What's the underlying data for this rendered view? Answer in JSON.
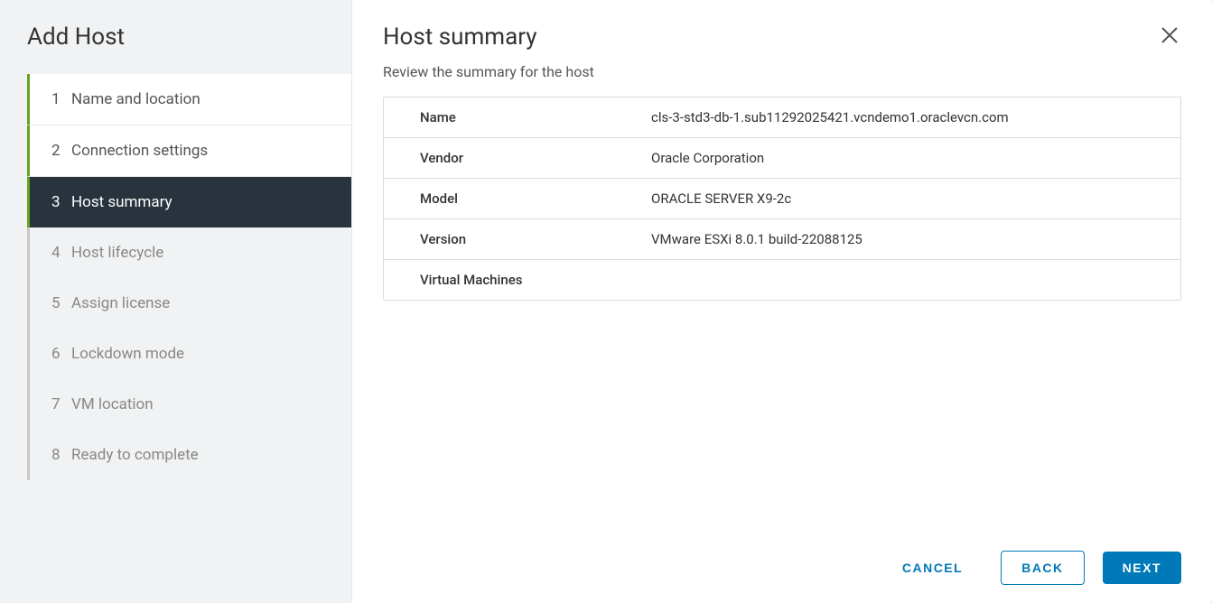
{
  "wizard": {
    "title": "Add Host",
    "steps": [
      {
        "num": "1",
        "label": "Name and location",
        "state": "completed"
      },
      {
        "num": "2",
        "label": "Connection settings",
        "state": "completed"
      },
      {
        "num": "3",
        "label": "Host summary",
        "state": "current"
      },
      {
        "num": "4",
        "label": "Host lifecycle",
        "state": "upcoming"
      },
      {
        "num": "5",
        "label": "Assign license",
        "state": "upcoming"
      },
      {
        "num": "6",
        "label": "Lockdown mode",
        "state": "upcoming"
      },
      {
        "num": "7",
        "label": "VM location",
        "state": "upcoming"
      },
      {
        "num": "8",
        "label": "Ready to complete",
        "state": "upcoming"
      }
    ]
  },
  "main": {
    "title": "Host summary",
    "subtitle": "Review the summary for the host",
    "rows": [
      {
        "label": "Name",
        "value": "cls-3-std3-db-1.sub11292025421.vcndemo1.oraclevcn.com"
      },
      {
        "label": "Vendor",
        "value": "Oracle Corporation"
      },
      {
        "label": "Model",
        "value": "ORACLE SERVER X9-2c"
      },
      {
        "label": "Version",
        "value": "VMware ESXi 8.0.1 build-22088125"
      },
      {
        "label": "Virtual Machines",
        "value": ""
      }
    ]
  },
  "footer": {
    "cancel": "CANCEL",
    "back": "BACK",
    "next": "NEXT"
  }
}
